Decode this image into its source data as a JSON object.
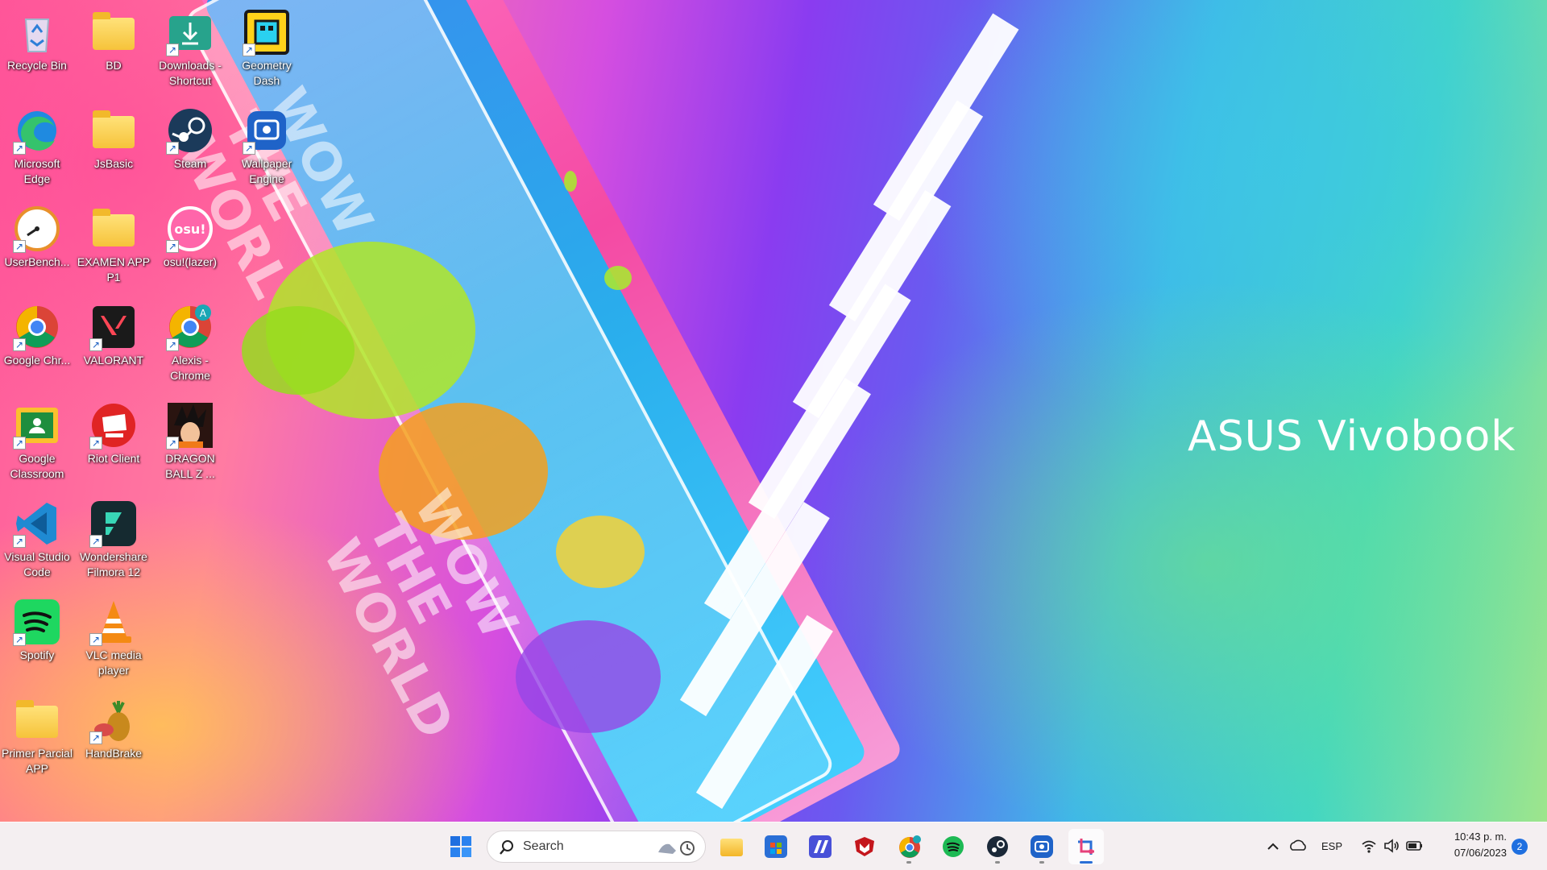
{
  "wallpaper": {
    "brand_text": "ASUS Vivobook",
    "slogan_1": "WOW\nTHE\nWORL",
    "slogan_2": "WOW\nTHE\nWORLD"
  },
  "desktop_icons": [
    {
      "label": "Recycle Bin",
      "icon": "recycle-bin-icon",
      "shortcut": false
    },
    {
      "label": "BD",
      "icon": "folder-icon",
      "shortcut": false
    },
    {
      "label": "Downloads - Shortcut",
      "icon": "downloads-icon",
      "shortcut": true
    },
    {
      "label": "Geometry Dash",
      "icon": "geometry-dash-icon",
      "shortcut": true
    },
    {
      "label": "Microsoft Edge",
      "icon": "edge-icon",
      "shortcut": true
    },
    {
      "label": "JsBasic",
      "icon": "folder-icon",
      "shortcut": false
    },
    {
      "label": "Steam",
      "icon": "steam-icon",
      "shortcut": true
    },
    {
      "label": "Wallpaper Engine",
      "icon": "wallpaper-engine-icon",
      "shortcut": true
    },
    {
      "label": "UserBench...",
      "icon": "userbenchmark-icon",
      "shortcut": true
    },
    {
      "label": "EXAMEN APP P1",
      "icon": "folder-icon",
      "shortcut": false
    },
    {
      "label": "osu!(lazer)",
      "icon": "osu-icon",
      "shortcut": true
    },
    {
      "label": "Google Chr...",
      "icon": "chrome-icon",
      "shortcut": true
    },
    {
      "label": "VALORANT",
      "icon": "valorant-icon",
      "shortcut": true
    },
    {
      "label": "Alexis - Chrome",
      "icon": "chrome-profile-icon",
      "shortcut": true
    },
    {
      "label": "Google Classroom",
      "icon": "classroom-icon",
      "shortcut": true
    },
    {
      "label": "Riot Client",
      "icon": "riot-client-icon",
      "shortcut": true
    },
    {
      "label": "DRAGON BALL Z ...",
      "icon": "dragon-ball-icon",
      "shortcut": true
    },
    {
      "label": "Visual Studio Code",
      "icon": "vscode-icon",
      "shortcut": true
    },
    {
      "label": "Wondershare Filmora 12",
      "icon": "filmora-icon",
      "shortcut": true
    },
    {
      "label": "Spotify",
      "icon": "spotify-icon",
      "shortcut": true
    },
    {
      "label": "VLC media player",
      "icon": "vlc-icon",
      "shortcut": true
    },
    {
      "label": "Primer Parcial APP",
      "icon": "folder-icon",
      "shortcut": false
    },
    {
      "label": "HandBrake",
      "icon": "handbrake-icon",
      "shortcut": true
    }
  ],
  "taskbar": {
    "search_placeholder": "Search",
    "pinned": [
      {
        "name": "start-button",
        "color": "#1f6fe0"
      },
      {
        "name": "file-explorer",
        "color": "#f5c03b"
      },
      {
        "name": "microsoft-store",
        "color": "#2a6fd6"
      },
      {
        "name": "mcafee-app",
        "color": "#4850d8"
      },
      {
        "name": "mcafee-security",
        "color": "#c4161c"
      },
      {
        "name": "chrome",
        "color": "#34a853"
      },
      {
        "name": "spotify",
        "color": "#1db954"
      },
      {
        "name": "steam",
        "color": "#1b2838"
      },
      {
        "name": "wallpaper-engine",
        "color": "#1f63c8"
      },
      {
        "name": "snipping-tool",
        "color": "#e6407a"
      }
    ],
    "tray": {
      "language": "ESP",
      "time": "10:43 p. m.",
      "date": "07/06/2023",
      "notification_count": "2"
    }
  }
}
